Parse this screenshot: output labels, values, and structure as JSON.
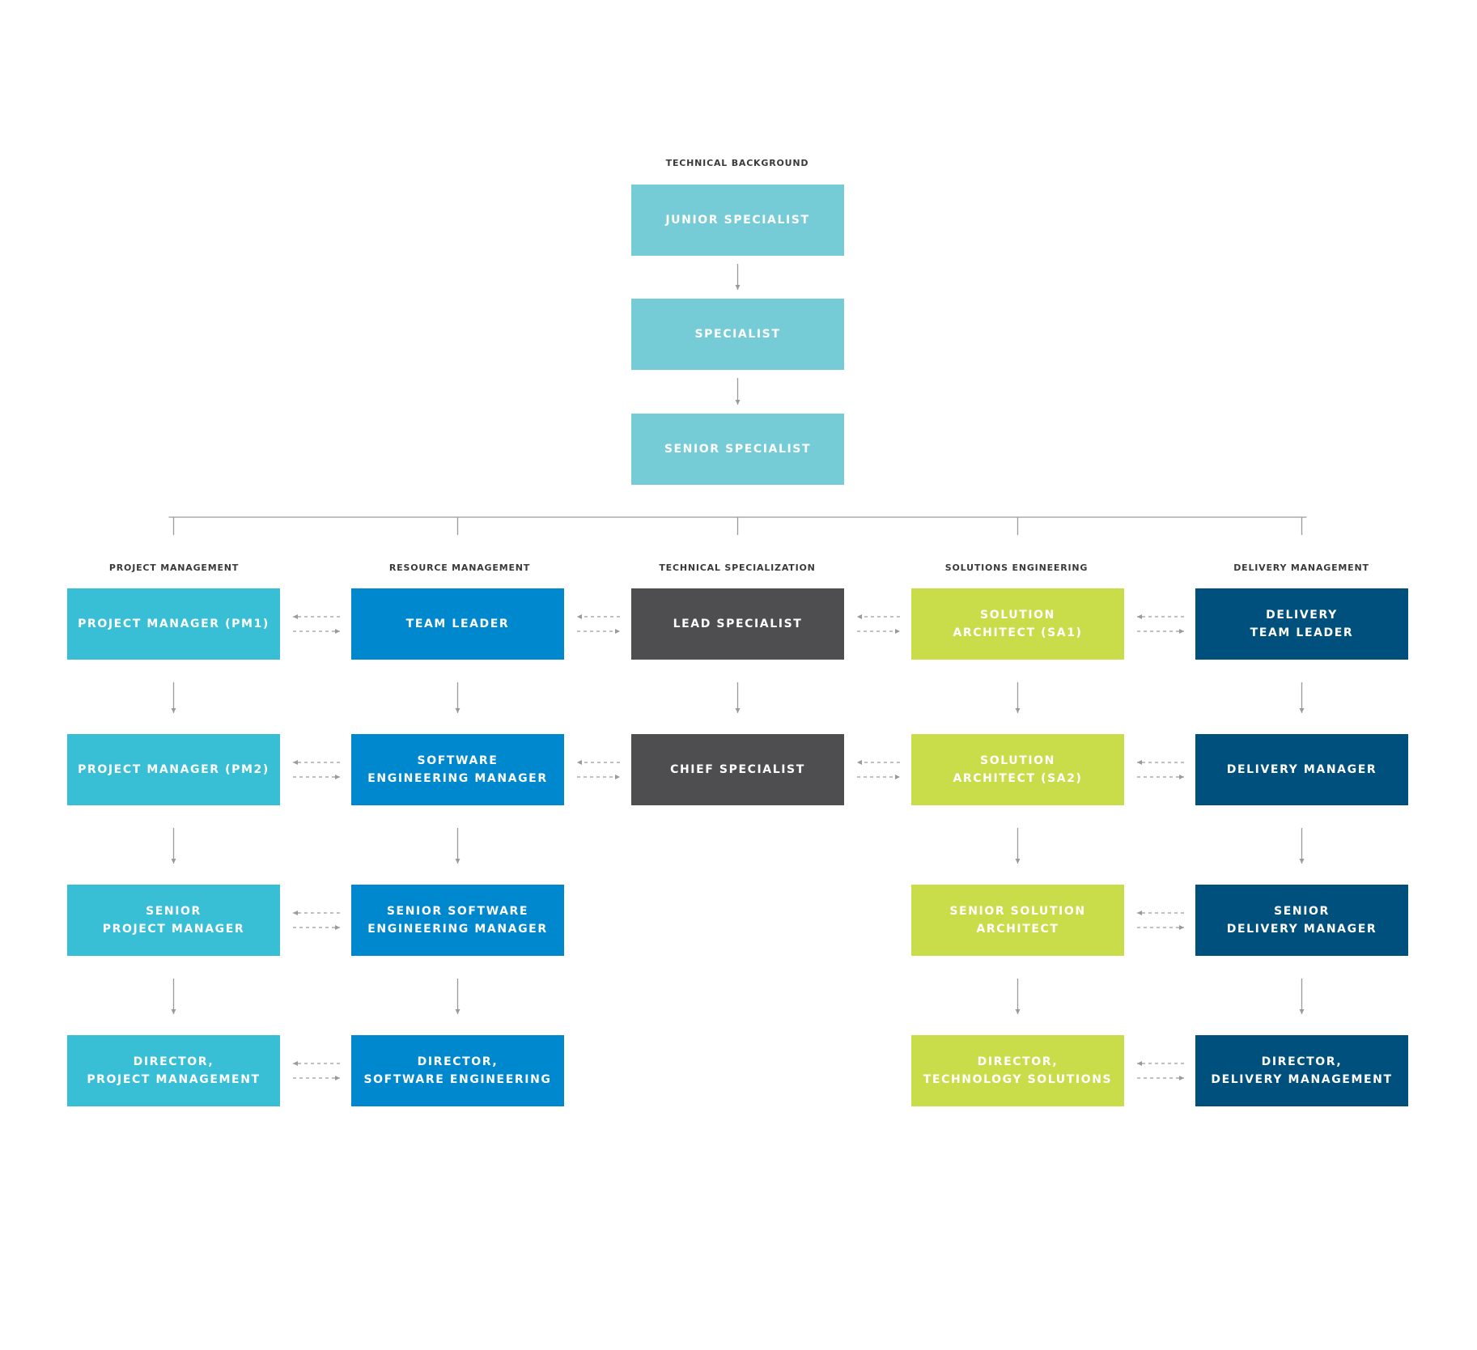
{
  "top": {
    "title": "TECHNICAL BACKGROUND",
    "boxes": [
      "JUNIOR SPECIALIST",
      "SPECIALIST",
      "SENIOR SPECIALIST"
    ],
    "color": "#75CCD7"
  },
  "columns": [
    {
      "title": "PROJECT MANAGEMENT",
      "color": "#38BFD5",
      "boxes": [
        "PROJECT MANAGER (PM1)",
        "PROJECT MANAGER (PM2)",
        "SENIOR\nPROJECT MANAGER",
        "DIRECTOR,\nPROJECT MANAGEMENT"
      ]
    },
    {
      "title": "RESOURCE MANAGEMENT",
      "color": "#0088CE",
      "boxes": [
        "TEAM LEADER",
        "SOFTWARE\nENGINEERING  MANAGER",
        "SENIOR SOFTWARE\nENGINEERING  MANAGER",
        "DIRECTOR,\nSOFTWARE ENGINEERING"
      ]
    },
    {
      "title": "TECHNICAL SPECIALIZATION",
      "color": "#4E4E50",
      "boxes": [
        "LEAD SPECIALIST",
        "CHIEF SPECIALIST"
      ]
    },
    {
      "title": "SOLUTIONS ENGINEERING",
      "color": "#C9DD4A",
      "boxes": [
        "SOLUTION\nARCHITECT (SA1)",
        "SOLUTION\nARCHITECT (SA2)",
        "SENIOR SOLUTION\nARCHITECT",
        "DIRECTOR,\nTECHNOLOGY SOLUTIONS"
      ]
    },
    {
      "title": "DELIVERY MANAGEMENT",
      "color": "#00507E",
      "boxes": [
        "DELIVERY\nTEAM LEADER",
        "DELIVERY MANAGER",
        "SENIOR\nDELIVERY MANAGER",
        "DIRECTOR,\nDELIVERY MANAGEMENT"
      ]
    }
  ]
}
